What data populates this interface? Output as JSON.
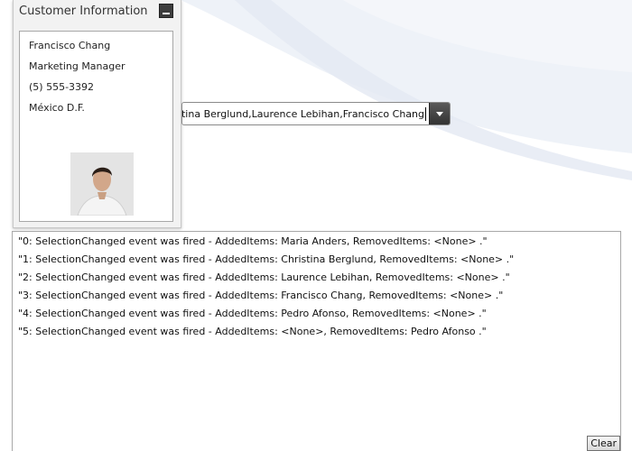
{
  "panel": {
    "title": "Customer Information",
    "card": {
      "name": "Francisco Chang",
      "role": "Marketing Manager",
      "phone": "(5) 555-3392",
      "city": "México D.F."
    }
  },
  "combo": {
    "text": "istina Berglund,Laurence Lebihan,Francisco Chang"
  },
  "log": {
    "lines": [
      "\"0: SelectionChanged event was fired - AddedItems: Maria Anders, RemovedItems: <None> .\"",
      "\"1: SelectionChanged event was fired - AddedItems: Christina Berglund, RemovedItems: <None> .\"",
      "\"2: SelectionChanged event was fired - AddedItems: Laurence Lebihan, RemovedItems: <None> .\"",
      "\"3: SelectionChanged event was fired - AddedItems: Francisco Chang, RemovedItems: <None> .\"",
      "\"4: SelectionChanged event was fired - AddedItems: Pedro Afonso, RemovedItems: <None> .\"",
      "\"5: SelectionChanged event was fired - AddedItems: <None>, RemovedItems: Pedro Afonso .\""
    ],
    "clear_label": "Clear"
  },
  "icons": {
    "collapse": "minus-icon",
    "dropdown": "chevron-down-icon"
  },
  "colors": {
    "panel_bg": "#f2f2f2",
    "button_dark": "#3d3d3d",
    "swoosh": "#e3e9f2"
  }
}
